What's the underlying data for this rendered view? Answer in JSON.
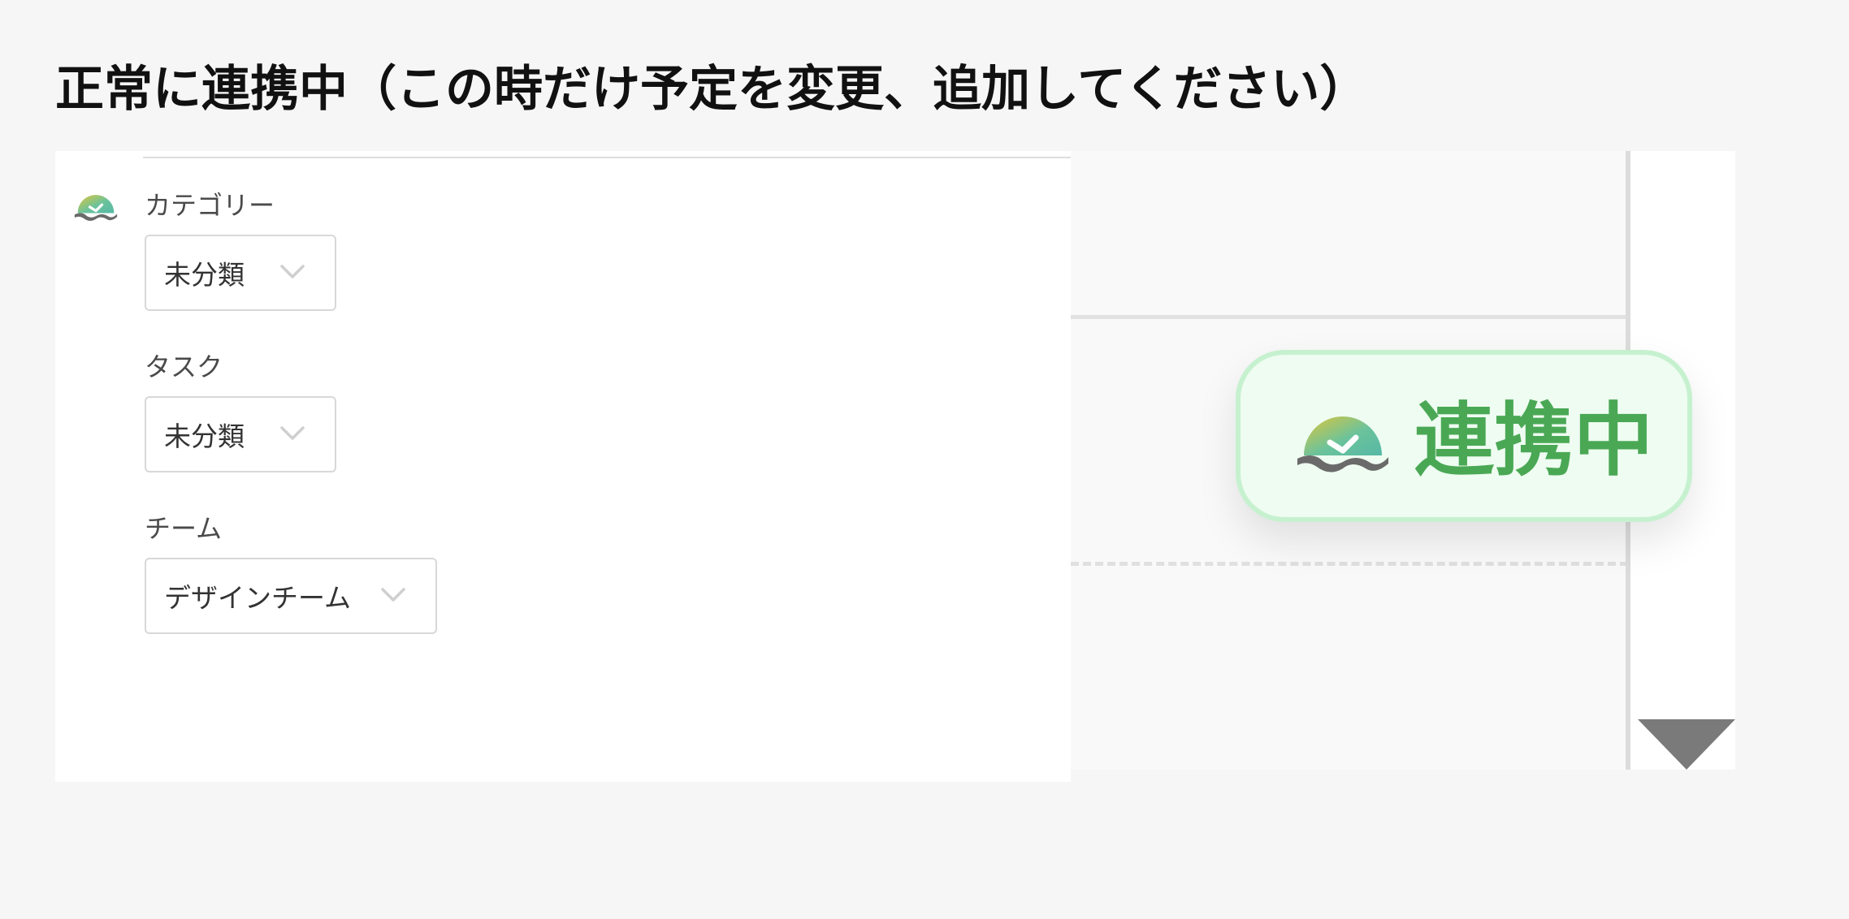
{
  "heading": "正常に連携中（この時だけ予定を変更、追加してください）",
  "form": {
    "fields": [
      {
        "label": "カテゴリー",
        "value": "未分類"
      },
      {
        "label": "タスク",
        "value": "未分類"
      },
      {
        "label": "チーム",
        "value": "デザインチーム"
      }
    ]
  },
  "badge": {
    "label": "連携中",
    "text_color": "#4aa855",
    "border_color": "#c6f1cf",
    "background_color": "#eefcf1"
  },
  "icons": {
    "app_logo": "clock-logo-icon",
    "select": "chevron-down-icon",
    "scroll": "triangle-down-icon"
  }
}
